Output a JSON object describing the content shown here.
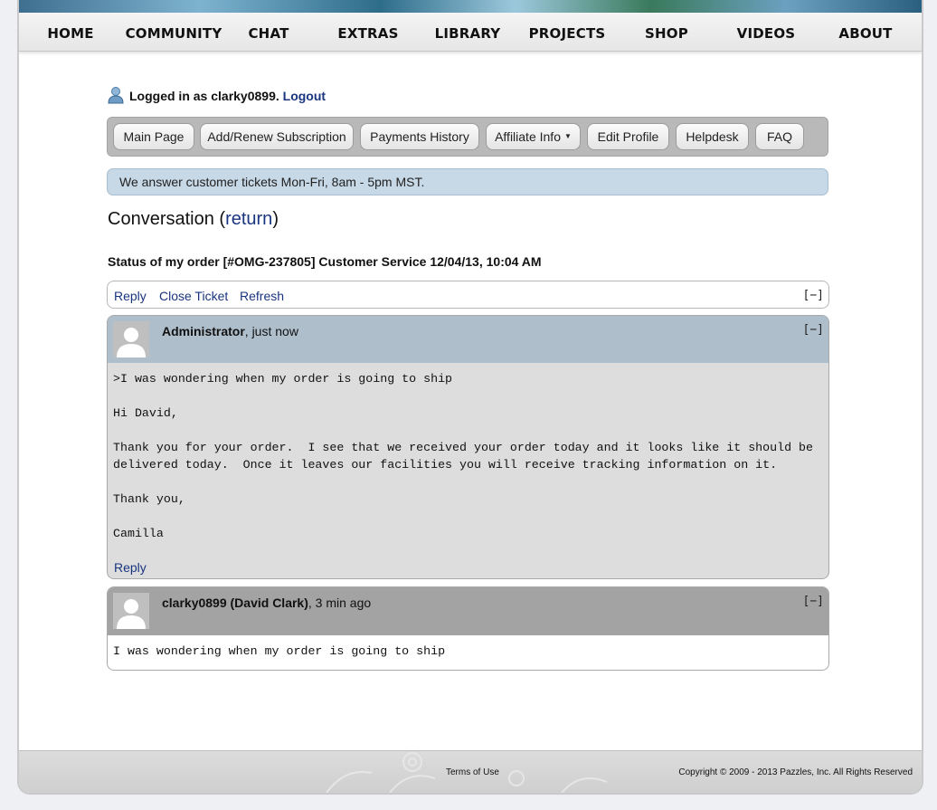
{
  "nav": [
    "HOME",
    "COMMUNITY",
    "CHAT",
    "EXTRAS",
    "LIBRARY",
    "PROJECTS",
    "SHOP",
    "VIDEOS",
    "ABOUT"
  ],
  "login": {
    "text": "Logged in as clarky0899.",
    "logout": "Logout"
  },
  "buttons": [
    "Main Page",
    "Add/Renew Subscription",
    "Payments History",
    "Affiliate Info",
    "Edit Profile",
    "Helpdesk",
    "FAQ"
  ],
  "notice": "We answer customer tickets Mon-Fri, 8am - 5pm MST.",
  "conversation": {
    "title_prefix": "Conversation (",
    "return": "return",
    "title_suffix": ")"
  },
  "subject": "Status of my order [#OMG-237805] Customer Service 12/04/13, 10:04 AM",
  "actions": {
    "reply": "Reply",
    "close": "Close Ticket",
    "refresh": "Refresh",
    "collapse": "[−]"
  },
  "messages": [
    {
      "author": "Administrator",
      "time": ", just now",
      "collapse": "[−]",
      "body": ">I was wondering when my order is going to ship\n\nHi David,\n\nThank you for your order.  I see that we received your order today and it looks like it should be\ndelivered today.  Once it leaves our facilities you will receive tracking information on it.\n\nThank you,\n\nCamilla",
      "reply": "Reply",
      "colors": {
        "header": "#aebecb",
        "body": "#dddddd"
      }
    },
    {
      "author": "clarky0899 (David Clark)",
      "time": ", 3 min ago",
      "collapse": "[−]",
      "body": "I was wondering when my order is going to ship",
      "colors": {
        "header": "#a3a3a3",
        "body": "#ffffff"
      }
    }
  ],
  "footer": {
    "terms": "Terms of Use",
    "copyright": "Copyright © 2009 - 2013 Pazzles, Inc. All Rights Reserved"
  },
  "colors": {
    "link": "#1a3580",
    "notice_bg": "#c7d8e6",
    "button_bar": "#b9b9b9"
  }
}
